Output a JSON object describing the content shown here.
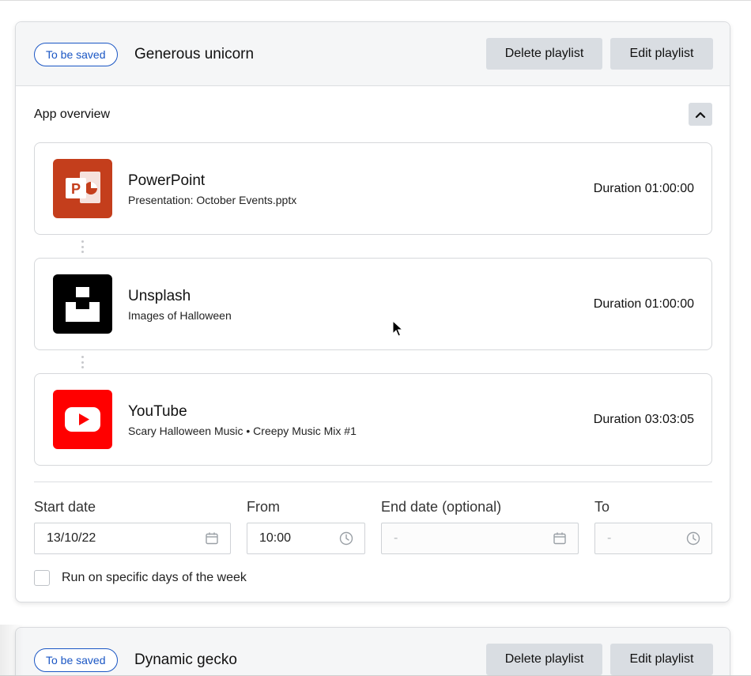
{
  "playlists": [
    {
      "badge": "To be saved",
      "name": "Generous unicorn",
      "delete_label": "Delete playlist",
      "edit_label": "Edit playlist",
      "overview_label": "App overview",
      "apps": [
        {
          "name": "PowerPoint",
          "description": "Presentation: October Events.pptx",
          "duration": "Duration 01:00:00",
          "icon": "powerpoint-icon",
          "color": "#c43e1c"
        },
        {
          "name": "Unsplash",
          "description": "Images of Halloween",
          "duration": "Duration 01:00:00",
          "icon": "unsplash-icon",
          "color": "#000000"
        },
        {
          "name": "YouTube",
          "description": "Scary Halloween Music • Creepy Music Mix #1",
          "duration": "Duration 03:03:05",
          "icon": "youtube-icon",
          "color": "#ff0000"
        }
      ],
      "schedule": {
        "start_date_label": "Start date",
        "start_date_value": "13/10/22",
        "from_label": "From",
        "from_value": "10:00",
        "end_date_label": "End date (optional)",
        "end_date_value": "-",
        "to_label": "To",
        "to_value": "-",
        "weekdays_label": "Run on specific days of the week"
      }
    },
    {
      "badge": "To be saved",
      "name": "Dynamic gecko",
      "delete_label": "Delete playlist",
      "edit_label": "Edit playlist"
    }
  ],
  "colors": {
    "accent": "#1a56c4",
    "button_bg": "#d9dde2",
    "header_bg": "#f5f6f7"
  }
}
